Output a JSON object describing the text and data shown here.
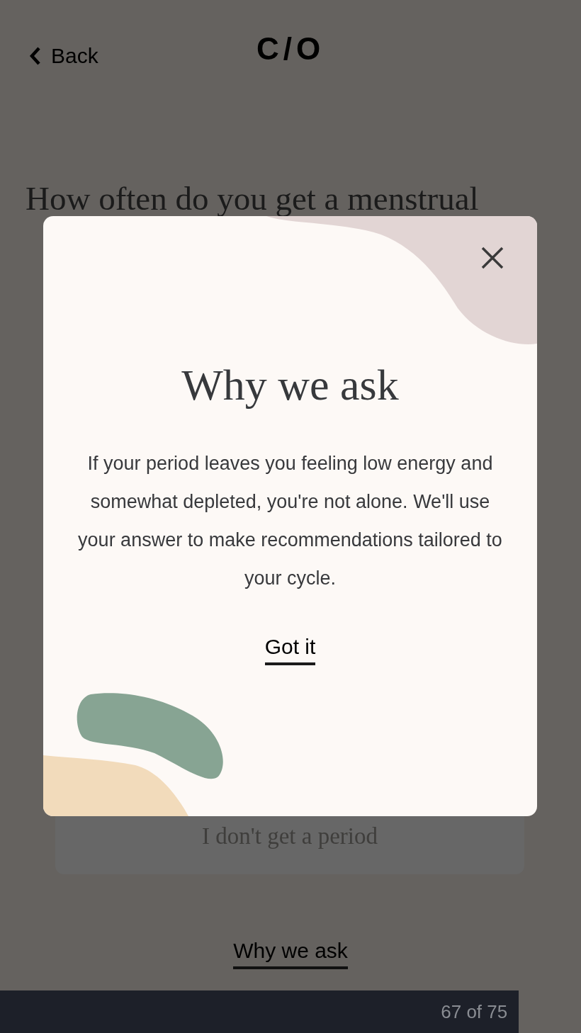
{
  "header": {
    "back_label": "Back",
    "logo": "C/O"
  },
  "question": {
    "title": "How often do you get a menstrual"
  },
  "options": [
    {
      "label": "I don't get a period"
    }
  ],
  "why_link": "Why we ask",
  "progress": {
    "level": 0.893,
    "label": "67 of 75"
  },
  "modal": {
    "title": "Why we ask",
    "body": "If your period leaves you feeling low energy and somewhat depleted, you're not alone. We'll use your answer to make recommendations tailored to your cycle.",
    "button": "Got it"
  }
}
